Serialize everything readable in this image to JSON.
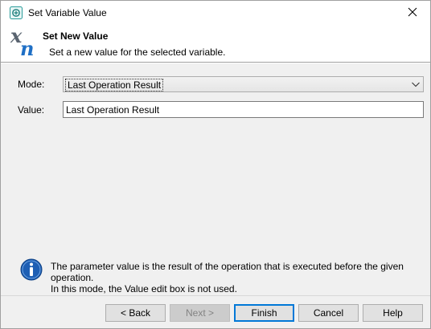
{
  "window": {
    "title": "Set Variable Value"
  },
  "header": {
    "title": "Set New Value",
    "subtitle": "Set a new value for the selected variable.",
    "icon": "variable-xn-icon"
  },
  "form": {
    "mode_label": "Mode:",
    "mode_value": "Last Operation Result",
    "value_label": "Value:",
    "value_value": "Last Operation Result"
  },
  "info": {
    "icon": "info-icon",
    "text_line1": "The parameter value is the result of the operation that is executed before the given operation.",
    "text_line2": "In this mode, the Value edit box is not used."
  },
  "buttons": {
    "back": "< Back",
    "next": "Next >",
    "finish": "Finish",
    "cancel": "Cancel",
    "help": "Help"
  },
  "colors": {
    "accent": "#0078d7",
    "info_blue": "#1e5fb4"
  }
}
